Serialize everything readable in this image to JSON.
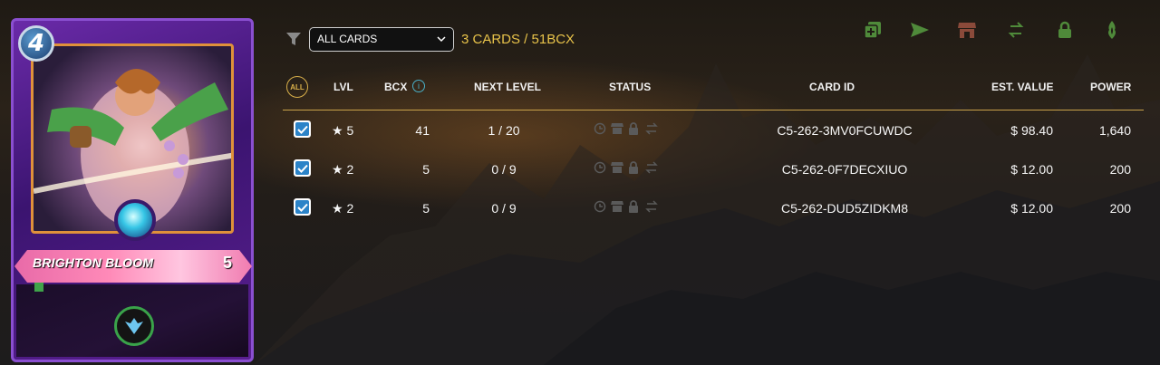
{
  "card": {
    "mana": "4",
    "name": "BRIGHTON BLOOM",
    "level": "5",
    "colors": {
      "frame": "#6a2aa8",
      "banner": "#ff8ab8",
      "gem": "#36c6e6"
    }
  },
  "toolbar": {
    "filter_icon": "filter-icon",
    "select_value": "ALL CARDS",
    "summary": "3 CARDS / 51BCX"
  },
  "actions": [
    {
      "icon": "add-card-icon",
      "color": "#4f8a3a"
    },
    {
      "icon": "send-icon",
      "color": "#4f8a3a"
    },
    {
      "icon": "market-icon",
      "color": "#8a4a3a"
    },
    {
      "icon": "transfer-icon",
      "color": "#4f8a3a"
    },
    {
      "icon": "lock-icon",
      "color": "#4f8a3a"
    },
    {
      "icon": "burn-icon",
      "color": "#4f8a3a"
    }
  ],
  "table": {
    "all_label": "ALL",
    "headers": {
      "lvl": "LVL",
      "bcx": "BCX",
      "next_level": "NEXT LEVEL",
      "status": "STATUS",
      "card_id": "CARD ID",
      "est_value": "EST. VALUE",
      "power": "POWER"
    },
    "rows": [
      {
        "checked": true,
        "lvl": "★ 5",
        "bcx": "41",
        "next_level": "1 / 20",
        "card_id": "C5-262-3MV0FCUWDC",
        "est_value": "$ 98.40",
        "power": "1,640"
      },
      {
        "checked": true,
        "lvl": "★ 2",
        "bcx": "5",
        "next_level": "0 / 9",
        "card_id": "C5-262-0F7DECXIUO",
        "est_value": "$ 12.00",
        "power": "200"
      },
      {
        "checked": true,
        "lvl": "★ 2",
        "bcx": "5",
        "next_level": "0 / 9",
        "card_id": "C5-262-DUD5ZIDKM8",
        "est_value": "$ 12.00",
        "power": "200"
      }
    ]
  }
}
